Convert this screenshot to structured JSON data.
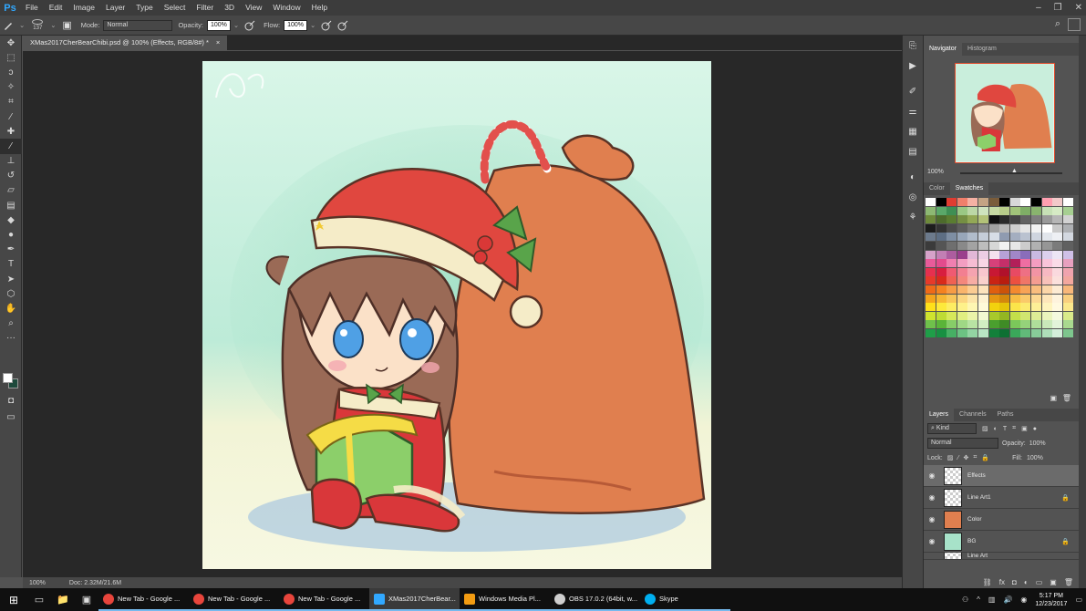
{
  "app": {
    "logo": "Ps"
  },
  "menu": [
    "File",
    "Edit",
    "Image",
    "Layer",
    "Type",
    "Select",
    "Filter",
    "3D",
    "View",
    "Window",
    "Help"
  ],
  "options": {
    "brush_size": "137",
    "mode_label": "Mode:",
    "mode_value": "Normal",
    "opacity_label": "Opacity:",
    "opacity_value": "100%",
    "flow_label": "Flow:",
    "flow_value": "100%"
  },
  "document": {
    "tab_title": "XMas2017CherBearChibi.psd @ 100% (Effects, RGB/8#) *",
    "close": "×",
    "zoom": "100%",
    "doc_size": "Doc: 2.32M/21.6M"
  },
  "navigator": {
    "tabs": [
      "Navigator",
      "Histogram"
    ],
    "zoom": "100%"
  },
  "swatches": {
    "tabs": [
      "Color",
      "Swatches"
    ],
    "colors": [
      "#ffffff",
      "#000000",
      "#e03c31",
      "#f07f6b",
      "#f5b1a3",
      "#c4a484",
      "#7a5c3a",
      "#000000",
      "#d8d8d8",
      "#ffffff",
      "#000000",
      "#ff9fb0",
      "#f2c9c9",
      "#ffffff",
      "#8db873",
      "#5aa869",
      "#3f8f54",
      "#9ac884",
      "#bcd7a6",
      "#cfe4bf",
      "#c6d9a3",
      "#b7cc8a",
      "#a1c47a",
      "#7fae66",
      "#89b46e",
      "#c7e1b6",
      "#d6ebc5",
      "#a6cf91",
      "#6e8a3b",
      "#4d6b2c",
      "#5a7d31",
      "#758f43",
      "#93a856",
      "#b3c278",
      "#101010",
      "#2a2a2a",
      "#464646",
      "#626262",
      "#7e7e7e",
      "#9a9a9a",
      "#b6b6b6",
      "#d2d2d2",
      "#1d1d1d",
      "#333333",
      "#4b4b4b",
      "#5e5e5e",
      "#747474",
      "#8a8a8a",
      "#a0a0a0",
      "#b8b8b8",
      "#cfcfcf",
      "#e5e5e5",
      "#f2f2f2",
      "#ffffff",
      "#c9c9c9",
      "#aeb0b3",
      "#6c7a8c",
      "#5d6e84",
      "#7e8ea3",
      "#98a6b9",
      "#b1bccb",
      "#c5cdd9",
      "#d7dde6",
      "#8f9bb0",
      "#a4aec0",
      "#bac2d0",
      "#cfd5df",
      "#e2e6ec",
      "#eef0f4",
      "#d3d8e0",
      "#3b3b3b",
      "#555555",
      "#6f6f6f",
      "#898989",
      "#a3a3a3",
      "#bdbdbd",
      "#d7d7d7",
      "#f1f1f1",
      "#e7e7e7",
      "#cccccc",
      "#b1b1b1",
      "#969696",
      "#7b7b7b",
      "#606060",
      "#d6a2c9",
      "#c27fb4",
      "#ad5d9f",
      "#9a3f8c",
      "#e2b7d7",
      "#eccde4",
      "#f4e0ef",
      "#b7a2d6",
      "#a187c8",
      "#8a6dba",
      "#c9b9e2",
      "#dcd0ed",
      "#ece5f5",
      "#cfc0e7",
      "#e85b9a",
      "#e34b8d",
      "#ef7fb0",
      "#f29ec1",
      "#f5bdd3",
      "#f8d7e5",
      "#d6417a",
      "#c52f69",
      "#b22059",
      "#ee6ea2",
      "#f39dc0",
      "#f8c4da",
      "#fadce8",
      "#e8a0bf",
      "#e6304f",
      "#d81e3f",
      "#ef5a72",
      "#f27f91",
      "#f5a3b0",
      "#f8c6ce",
      "#c81834",
      "#b0112b",
      "#e84a63",
      "#ee7084",
      "#f394a4",
      "#f7b8c2",
      "#fad9de",
      "#f0a3ae",
      "#e73a2a",
      "#d92b1b",
      "#ef6153",
      "#f3877c",
      "#f6aca4",
      "#f9d0cc",
      "#c92414",
      "#b81d0f",
      "#ec5040",
      "#f07668",
      "#f49c91",
      "#f8c1ba",
      "#fbe0dc",
      "#f3a79e",
      "#f06a18",
      "#f58220",
      "#f79c45",
      "#f9b46b",
      "#fbcc92",
      "#fde3bc",
      "#e05f0f",
      "#cc530a",
      "#f4892f",
      "#f7a356",
      "#f9bd7e",
      "#fbd6a8",
      "#fdebd3",
      "#f8b77a",
      "#f5a51b",
      "#f7b733",
      "#f9c659",
      "#fbd580",
      "#fce4a8",
      "#fef2d2",
      "#e69612",
      "#d4880d",
      "#f8bc44",
      "#fac96a",
      "#fcd892",
      "#fde6ba",
      "#fef3dd",
      "#f9cf7f",
      "#ffe01a",
      "#fde93b",
      "#fded62",
      "#fef18a",
      "#fef6b2",
      "#fffad9",
      "#f2d20e",
      "#e6c509",
      "#fbe54a",
      "#fcea70",
      "#fdef97",
      "#fef4be",
      "#fff9e0",
      "#fbe88c",
      "#cfe32e",
      "#bedb35",
      "#d6e85a",
      "#e0ee81",
      "#eaf3a8",
      "#f3f9d1",
      "#a8c92b",
      "#93b622",
      "#c3df4a",
      "#d1e670",
      "#deed96",
      "#ebf4bd",
      "#f5fade",
      "#d9ea8a",
      "#6fc14b",
      "#5ab439",
      "#87cd68",
      "#9fd885",
      "#b8e3a3",
      "#d1eec2",
      "#4a9f2e",
      "#3f8b26",
      "#7bc85a",
      "#95d37a",
      "#afde9a",
      "#c9e9ba",
      "#e2f4da",
      "#a9d98f",
      "#1f9e48",
      "#179042",
      "#46b064",
      "#6cc283",
      "#93d4a3",
      "#b9e6c4",
      "#12803a",
      "#0e7033",
      "#3aa85a",
      "#61ba79",
      "#88cc99",
      "#aedeb9",
      "#d4efdb",
      "#7dc68d"
    ]
  },
  "layers": {
    "tabs": [
      "Layers",
      "Channels",
      "Paths"
    ],
    "kind": "Kind",
    "blend": "Normal",
    "opacity_label": "Opacity:",
    "opacity_value": "100%",
    "lock_label": "Lock:",
    "fill_label": "Fill:",
    "fill_value": "100%",
    "items": [
      {
        "name": "Effects",
        "selected": true,
        "locked": false
      },
      {
        "name": "Line Art1",
        "selected": false,
        "locked": true
      },
      {
        "name": "Color",
        "selected": false,
        "locked": false
      },
      {
        "name": "BG",
        "selected": false,
        "locked": true
      },
      {
        "name": "Line Art",
        "selected": false,
        "locked": false
      }
    ]
  },
  "taskbar": {
    "apps": [
      {
        "label": "New Tab - Google ...",
        "color": "#e8453c"
      },
      {
        "label": "New Tab - Google ...",
        "color": "#e8453c"
      },
      {
        "label": "New Tab - Google ...",
        "color": "#e8453c"
      },
      {
        "label": "XMas2017CherBear...",
        "color": "#31a8ff"
      },
      {
        "label": "Windows Media Pl...",
        "color": "#f39c12"
      },
      {
        "label": "OBS 17.0.2 (64bit, w...",
        "color": "#cfcfcf"
      },
      {
        "label": "Skype",
        "color": "#00aff0"
      }
    ],
    "time": "5:17 PM",
    "date": "12/23/2017"
  }
}
